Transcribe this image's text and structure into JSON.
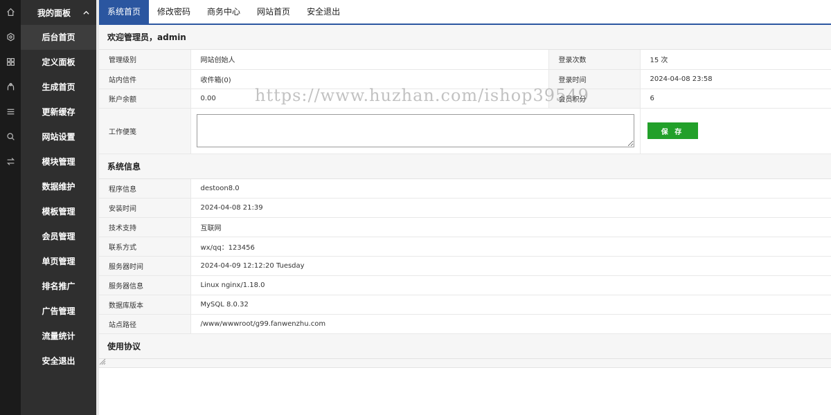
{
  "rail": {
    "icons": [
      "home-icon",
      "settings-icon",
      "grid-icon",
      "user-icon",
      "list-icon",
      "search-icon",
      "swap-icon"
    ]
  },
  "sidebar": {
    "title": "我的面板",
    "items": [
      {
        "label": "后台首页",
        "active": true
      },
      {
        "label": "定义面板"
      },
      {
        "label": "生成首页"
      },
      {
        "label": "更新缓存"
      },
      {
        "label": "网站设置"
      },
      {
        "label": "模块管理"
      },
      {
        "label": "数据维护"
      },
      {
        "label": "模板管理"
      },
      {
        "label": "会员管理"
      },
      {
        "label": "单页管理"
      },
      {
        "label": "排名推广"
      },
      {
        "label": "广告管理"
      },
      {
        "label": "流量统计"
      },
      {
        "label": "安全退出"
      }
    ]
  },
  "topnav": {
    "tabs": [
      "系统首页",
      "修改密码",
      "商务中心",
      "网站首页",
      "安全退出"
    ]
  },
  "welcome": {
    "title": "欢迎管理员，admin",
    "rows": [
      {
        "label": "管理级别",
        "value": "网站创始人",
        "label2": "登录次数",
        "value2": "15 次"
      },
      {
        "label": "站内信件",
        "value": "收件箱(0)",
        "label2": "登录时间",
        "value2": "2024-04-08 23:58"
      },
      {
        "label": "账户余额",
        "value": "0.00",
        "label2": "会员积分",
        "value2": "6"
      }
    ],
    "memo_label": "工作便笺",
    "memo_value": "",
    "save_label": "保 存"
  },
  "sysinfo": {
    "title": "系统信息",
    "rows": [
      {
        "label": "程序信息",
        "value": "destoon8.0"
      },
      {
        "label": "安装时间",
        "value": "2024-04-08 21:39"
      },
      {
        "label": "技术支持",
        "value": "互联网"
      },
      {
        "label": "联系方式",
        "value": "wx/qq：123456"
      },
      {
        "label": "服务器时间",
        "value": "2024-04-09 12:12:20 Tuesday"
      },
      {
        "label": "服务器信息",
        "value": "Linux nginx/1.18.0"
      },
      {
        "label": "数据库版本",
        "value": "MySQL 8.0.32"
      },
      {
        "label": "站点路径",
        "value": "/www/wwwroot/g99.fanwenzhu.com"
      }
    ]
  },
  "agreement": {
    "title": "使用协议"
  },
  "watermark": "https://www.huzhan.com/ishop39549",
  "colors": {
    "rail": "#1b1b1b",
    "sidebar": "#2f2f2f",
    "accent": "#2b56a0",
    "save": "#22a02a"
  }
}
